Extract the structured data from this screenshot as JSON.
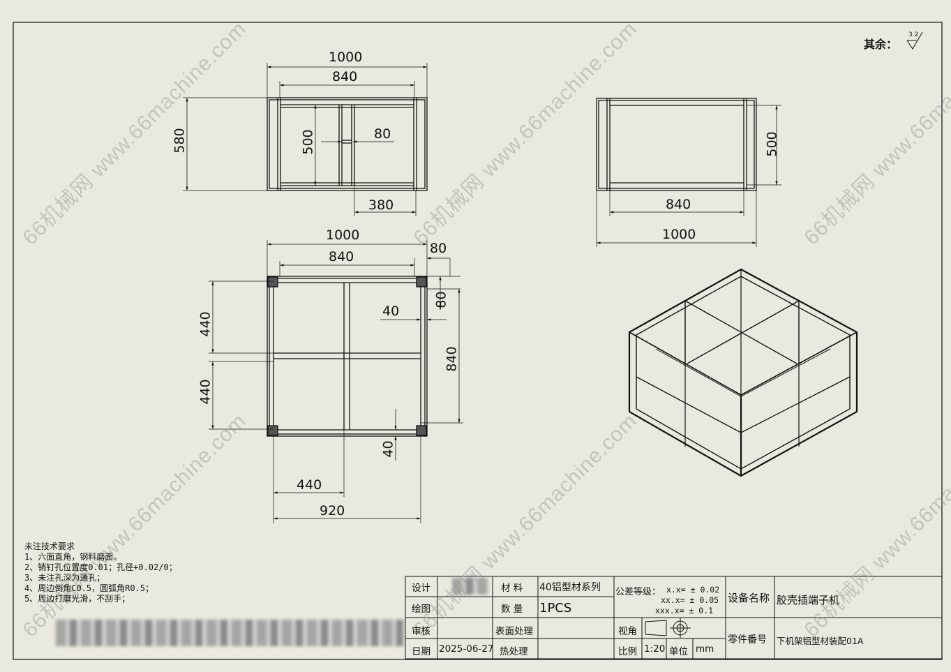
{
  "toolbar": {
    "icons": [
      "zoom-fit-icon",
      "zoom-area-icon",
      "zoom-in-out-icon",
      "pan-icon",
      "rotate-icon",
      "view-orientation-icon",
      "display-style-icon",
      "section-view-icon",
      "appearance-icon"
    ]
  },
  "roughness": {
    "label": "其余：",
    "value": "3.2"
  },
  "front_view": {
    "dim_width": "1000",
    "dim_inner": "840",
    "dim_height": "580",
    "dim_inner_height": "500",
    "dim_gap": "80",
    "dim_offset": "380"
  },
  "side_view": {
    "dim_height": "500",
    "dim_inner": "840",
    "dim_width": "1000"
  },
  "top_view": {
    "dim_width": "1000",
    "dim_inner": "840",
    "dim_corner": "80",
    "dim_corner_v": "80",
    "dim_40": "40",
    "dim_440_top": "440",
    "dim_440_bottom": "440",
    "dim_840": "840",
    "dim_40_bottom": "40",
    "dim_440_h": "440",
    "dim_920": "920"
  },
  "notes": {
    "title": "未注技术要求",
    "lines": [
      "1、六面直角，钢料磨面。",
      "2、销钉孔位置度0.01；孔径+0.02/0；",
      "3、未注孔深为通孔；",
      "4、周边倒角C0.5，圆弧角R0.5；",
      "5、周边打磨光滑，不刮手；"
    ]
  },
  "title_block": {
    "design_label": "设计",
    "drawing_label": "绘图",
    "review_label": "审核",
    "date_label": "日期",
    "date_value": "2025-06-27",
    "material_label": "材  料",
    "material_value": "40铝型材系列",
    "quantity_label": "数  量",
    "quantity_value": "1PCS",
    "surface_label": "表面处理",
    "heat_label": "热处理",
    "tolerance_label": "公差等级：",
    "tol_1": "x.x= ± 0.02",
    "tol_2": "xx.x= ± 0.05",
    "tol_3": "xxx.x= ± 0.1",
    "view_label": "视角",
    "scale_label": "比例",
    "scale_value": "1:20",
    "unit_label": "单位",
    "unit_value": "mm",
    "equipment_label": "设备名称",
    "equipment_value": "胶壳插端子机",
    "part_label": "零件番号",
    "part_value": "下机架铝型材装配01A"
  },
  "watermark": "66机械网 www.66machine.com"
}
